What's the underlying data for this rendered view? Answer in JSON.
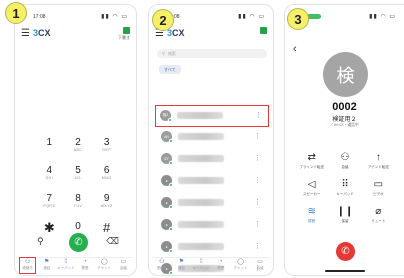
{
  "badges": [
    "1",
    "2",
    "3"
  ],
  "common": {
    "logo_num": "3",
    "logo_text": "CX",
    "time": "17:08"
  },
  "dialer": {
    "top_right_text": "下書き",
    "keys": [
      {
        "digit": "1",
        "letters": ""
      },
      {
        "digit": "2",
        "letters": "ABC"
      },
      {
        "digit": "3",
        "letters": "DEF"
      },
      {
        "digit": "4",
        "letters": "GHI"
      },
      {
        "digit": "5",
        "letters": "JKL"
      },
      {
        "digit": "6",
        "letters": "MNO"
      },
      {
        "digit": "7",
        "letters": "PQRS"
      },
      {
        "digit": "8",
        "letters": "TUV"
      },
      {
        "digit": "9",
        "letters": "WXYZ"
      },
      {
        "digit": "✱",
        "letters": ""
      },
      {
        "digit": "0",
        "letters": "+"
      },
      {
        "digit": "#",
        "letters": ""
      }
    ],
    "nav": [
      "連絡先",
      "通話",
      "キーパッド",
      "履歴",
      "チャット",
      "会議"
    ]
  },
  "contacts": {
    "search_placeholder": "検索",
    "filter_chip": "すべて",
    "avatar_initials": [
      "検2",
      "AN",
      "SY",
      "",
      "",
      "",
      "",
      ""
    ]
  },
  "call": {
    "avatar_char": "検",
    "extension": "0002",
    "name": "検証用２",
    "sub_prefix": "",
    "sub_text": "00:03・通話中",
    "controls": [
      {
        "icon": "transfer-icon",
        "glyph": "⇄",
        "label": "ブラインド転送"
      },
      {
        "icon": "conference-icon",
        "glyph": "⚇",
        "label": "会議"
      },
      {
        "icon": "attended-transfer-icon",
        "glyph": "↑",
        "label": "アテンド転送"
      },
      {
        "icon": "speaker-icon",
        "glyph": "◁",
        "label": "スピーカー"
      },
      {
        "icon": "keypad-icon",
        "glyph": "⠿",
        "label": "キーパッド"
      },
      {
        "icon": "video-icon",
        "glyph": "▭",
        "label": "ビデオ"
      },
      {
        "icon": "record-icon",
        "glyph": "≋",
        "label": "録音"
      },
      {
        "icon": "hold-icon",
        "glyph": "❙❙",
        "label": "保留"
      },
      {
        "icon": "mute-icon",
        "glyph": "⌀",
        "label": "ミュート"
      }
    ]
  }
}
